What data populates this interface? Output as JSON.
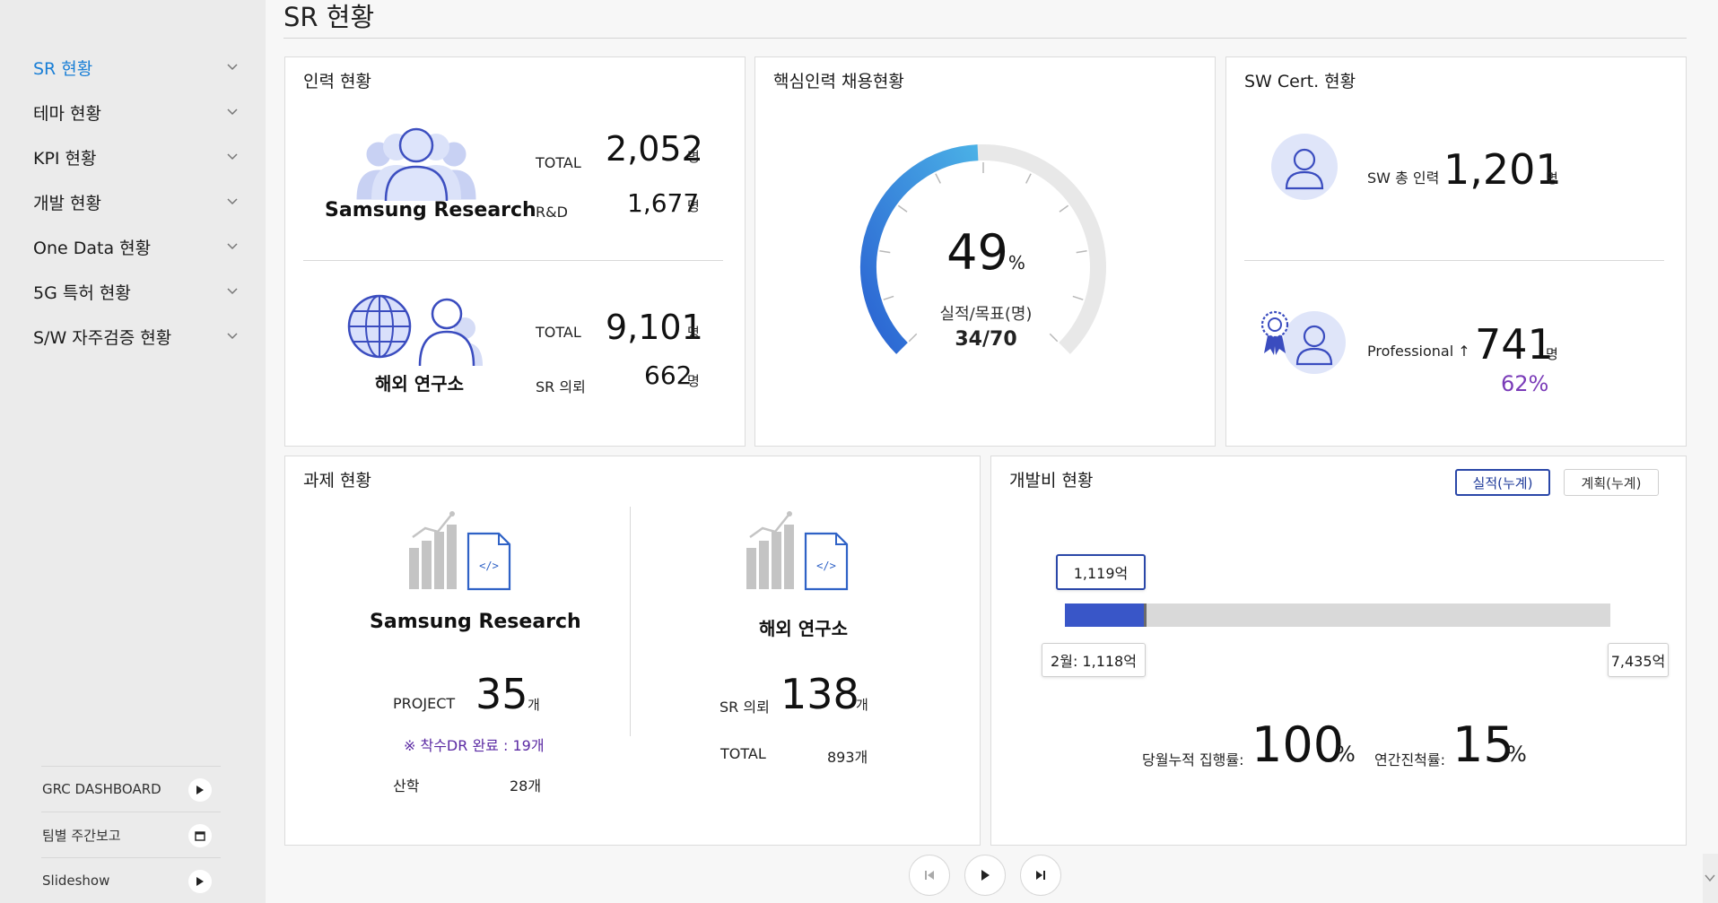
{
  "sidebar": {
    "items": [
      {
        "label": "SR 현황"
      },
      {
        "label": "테마 현황"
      },
      {
        "label": "KPI 현황"
      },
      {
        "label": "개발 현황"
      },
      {
        "label": "One Data 현황"
      },
      {
        "label": "5G 특허 현황"
      },
      {
        "label": "S/W 자주검증 현황"
      }
    ],
    "bottom_links": [
      {
        "label": "GRC DASHBOARD",
        "icon": "play-icon"
      },
      {
        "label": "팀별 주간보고",
        "icon": "window-icon"
      },
      {
        "label": "Slideshow",
        "icon": "play-icon"
      }
    ]
  },
  "page": {
    "title": "SR 현황"
  },
  "manpower": {
    "title": "인력 현황",
    "sr": {
      "name": "Samsung Research",
      "total_label": "TOTAL",
      "total_value": "2,052",
      "total_unit": "명",
      "rnd_label": "R&D",
      "rnd_value": "1,677",
      "rnd_unit": "명"
    },
    "overseas": {
      "name": "해외 연구소",
      "total_label": "TOTAL",
      "total_value": "9,101",
      "total_unit": "명",
      "sr_label": "SR 의뢰",
      "sr_value": "662",
      "sr_unit": "명"
    }
  },
  "recruit": {
    "title": "핵심인력 채용현황",
    "percent": "49",
    "percent_unit": "%",
    "sub_label": "실적/목표(명)",
    "ratio": "34/70",
    "fraction": 0.49,
    "colors": {
      "start": "#2a62d2",
      "end": "#4ab0e6",
      "track": "#e8e8e8"
    }
  },
  "swcert": {
    "title": "SW Cert. 현황",
    "total_label": "SW 총 인력",
    "total_value": "1,201",
    "total_unit": "명",
    "pro_label": "Professional ↑",
    "pro_value": "741",
    "pro_unit": "명",
    "pro_percent": "62%"
  },
  "projects": {
    "title": "과제 현황",
    "sr": {
      "name": "Samsung Research",
      "project_label": "PROJECT",
      "project_value": "35",
      "project_unit": "개",
      "note": "※ 착수DR 완료 : 19개",
      "industry_label": "산학",
      "industry_value": "28개"
    },
    "overseas": {
      "name": "해외 연구소",
      "sr_label": "SR 의뢰",
      "sr_value": "138",
      "sr_unit": "개",
      "total_label": "TOTAL",
      "total_value": "893개"
    }
  },
  "budget": {
    "title": "개발비 현황",
    "btn_actual": "실적(누계)",
    "btn_plan": "계획(누계)",
    "actual_tag": "1,119억",
    "month_tag": "2월: 1,118억",
    "plan_tag": "7,435억",
    "actual_fraction": 0.15,
    "rate_label": "당월누적 집행률:",
    "rate_value": "100",
    "rate_unit": "%",
    "progress_label": "연간진척률:",
    "progress_value": "15",
    "progress_unit": "%",
    "colors": {
      "bar": "#3956c8",
      "track": "#d9d9d9"
    }
  }
}
